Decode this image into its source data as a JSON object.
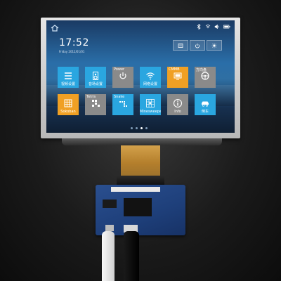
{
  "screen": {
    "clock": {
      "time": "17:52",
      "date": "Friday 2012/01/01"
    },
    "tiles": [
      {
        "id": "video",
        "label": "视频设置",
        "color": "#2aa6e0",
        "icon": "list-icon"
      },
      {
        "id": "audio",
        "label": "音场设置",
        "color": "#2aa6e0",
        "icon": "speaker-icon"
      },
      {
        "id": "power",
        "top_label": "Power",
        "label": "",
        "color": "#8a8a8a",
        "icon": "power-icon"
      },
      {
        "id": "network",
        "label": "网络设置",
        "color": "#2aa6e0",
        "icon": "wifi-icon"
      },
      {
        "id": "cmmb",
        "top_label": "CMMB",
        "label": "",
        "color": "#f0a024",
        "icon": "tv-icon"
      },
      {
        "id": "steering",
        "top_label": "方向盘",
        "label": "",
        "color": "#8a8a8a",
        "icon": "steering-wheel-icon"
      },
      {
        "id": "sokoban",
        "label": "Sokoban",
        "color": "#f0a024",
        "icon": "grid-icon"
      },
      {
        "id": "tetris",
        "top_label": "Tetris",
        "label": "",
        "color": "#8a8a8a",
        "icon": "blocks-icon"
      },
      {
        "id": "snake",
        "top_label": "Snake",
        "label": "",
        "color": "#2aa6e0",
        "icon": "snake-icon"
      },
      {
        "id": "minesweeper",
        "label": "Minesweeper",
        "color": "#2aa6e0",
        "icon": "mine-icon"
      },
      {
        "id": "info",
        "label": "Info",
        "color": "#8a8a8a",
        "icon": "info-icon"
      },
      {
        "id": "reversing",
        "label": "倒车",
        "color": "#2aa6e0",
        "icon": "car-icon"
      }
    ],
    "page_dots": {
      "count": 4,
      "active": 2
    }
  }
}
